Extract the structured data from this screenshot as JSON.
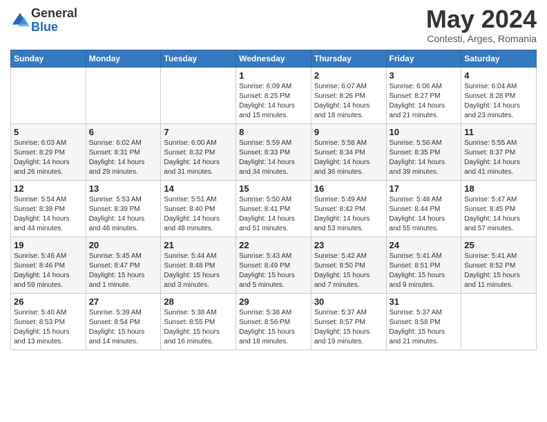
{
  "logo": {
    "general": "General",
    "blue": "Blue"
  },
  "title": "May 2024",
  "location": "Contesti, Arges, Romania",
  "days_of_week": [
    "Sunday",
    "Monday",
    "Tuesday",
    "Wednesday",
    "Thursday",
    "Friday",
    "Saturday"
  ],
  "weeks": [
    [
      {
        "day": "",
        "info": ""
      },
      {
        "day": "",
        "info": ""
      },
      {
        "day": "",
        "info": ""
      },
      {
        "day": "1",
        "info": "Sunrise: 6:09 AM\nSunset: 8:25 PM\nDaylight: 14 hours\nand 15 minutes."
      },
      {
        "day": "2",
        "info": "Sunrise: 6:07 AM\nSunset: 8:26 PM\nDaylight: 14 hours\nand 18 minutes."
      },
      {
        "day": "3",
        "info": "Sunrise: 6:06 AM\nSunset: 8:27 PM\nDaylight: 14 hours\nand 21 minutes."
      },
      {
        "day": "4",
        "info": "Sunrise: 6:04 AM\nSunset: 8:28 PM\nDaylight: 14 hours\nand 23 minutes."
      }
    ],
    [
      {
        "day": "5",
        "info": "Sunrise: 6:03 AM\nSunset: 8:29 PM\nDaylight: 14 hours\nand 26 minutes."
      },
      {
        "day": "6",
        "info": "Sunrise: 6:02 AM\nSunset: 8:31 PM\nDaylight: 14 hours\nand 29 minutes."
      },
      {
        "day": "7",
        "info": "Sunrise: 6:00 AM\nSunset: 8:32 PM\nDaylight: 14 hours\nand 31 minutes."
      },
      {
        "day": "8",
        "info": "Sunrise: 5:59 AM\nSunset: 8:33 PM\nDaylight: 14 hours\nand 34 minutes."
      },
      {
        "day": "9",
        "info": "Sunrise: 5:58 AM\nSunset: 8:34 PM\nDaylight: 14 hours\nand 36 minutes."
      },
      {
        "day": "10",
        "info": "Sunrise: 5:56 AM\nSunset: 8:35 PM\nDaylight: 14 hours\nand 39 minutes."
      },
      {
        "day": "11",
        "info": "Sunrise: 5:55 AM\nSunset: 8:37 PM\nDaylight: 14 hours\nand 41 minutes."
      }
    ],
    [
      {
        "day": "12",
        "info": "Sunrise: 5:54 AM\nSunset: 8:38 PM\nDaylight: 14 hours\nand 44 minutes."
      },
      {
        "day": "13",
        "info": "Sunrise: 5:53 AM\nSunset: 8:39 PM\nDaylight: 14 hours\nand 46 minutes."
      },
      {
        "day": "14",
        "info": "Sunrise: 5:51 AM\nSunset: 8:40 PM\nDaylight: 14 hours\nand 48 minutes."
      },
      {
        "day": "15",
        "info": "Sunrise: 5:50 AM\nSunset: 8:41 PM\nDaylight: 14 hours\nand 51 minutes."
      },
      {
        "day": "16",
        "info": "Sunrise: 5:49 AM\nSunset: 8:42 PM\nDaylight: 14 hours\nand 53 minutes."
      },
      {
        "day": "17",
        "info": "Sunrise: 5:48 AM\nSunset: 8:44 PM\nDaylight: 14 hours\nand 55 minutes."
      },
      {
        "day": "18",
        "info": "Sunrise: 5:47 AM\nSunset: 8:45 PM\nDaylight: 14 hours\nand 57 minutes."
      }
    ],
    [
      {
        "day": "19",
        "info": "Sunrise: 5:46 AM\nSunset: 8:46 PM\nDaylight: 14 hours\nand 59 minutes."
      },
      {
        "day": "20",
        "info": "Sunrise: 5:45 AM\nSunset: 8:47 PM\nDaylight: 15 hours\nand 1 minute."
      },
      {
        "day": "21",
        "info": "Sunrise: 5:44 AM\nSunset: 8:48 PM\nDaylight: 15 hours\nand 3 minutes."
      },
      {
        "day": "22",
        "info": "Sunrise: 5:43 AM\nSunset: 8:49 PM\nDaylight: 15 hours\nand 5 minutes."
      },
      {
        "day": "23",
        "info": "Sunrise: 5:42 AM\nSunset: 8:50 PM\nDaylight: 15 hours\nand 7 minutes."
      },
      {
        "day": "24",
        "info": "Sunrise: 5:41 AM\nSunset: 8:51 PM\nDaylight: 15 hours\nand 9 minutes."
      },
      {
        "day": "25",
        "info": "Sunrise: 5:41 AM\nSunset: 8:52 PM\nDaylight: 15 hours\nand 11 minutes."
      }
    ],
    [
      {
        "day": "26",
        "info": "Sunrise: 5:40 AM\nSunset: 8:53 PM\nDaylight: 15 hours\nand 13 minutes."
      },
      {
        "day": "27",
        "info": "Sunrise: 5:39 AM\nSunset: 8:54 PM\nDaylight: 15 hours\nand 14 minutes."
      },
      {
        "day": "28",
        "info": "Sunrise: 5:38 AM\nSunset: 8:55 PM\nDaylight: 15 hours\nand 16 minutes."
      },
      {
        "day": "29",
        "info": "Sunrise: 5:38 AM\nSunset: 8:56 PM\nDaylight: 15 hours\nand 18 minutes."
      },
      {
        "day": "30",
        "info": "Sunrise: 5:37 AM\nSunset: 8:57 PM\nDaylight: 15 hours\nand 19 minutes."
      },
      {
        "day": "31",
        "info": "Sunrise: 5:37 AM\nSunset: 8:58 PM\nDaylight: 15 hours\nand 21 minutes."
      },
      {
        "day": "",
        "info": ""
      }
    ]
  ]
}
